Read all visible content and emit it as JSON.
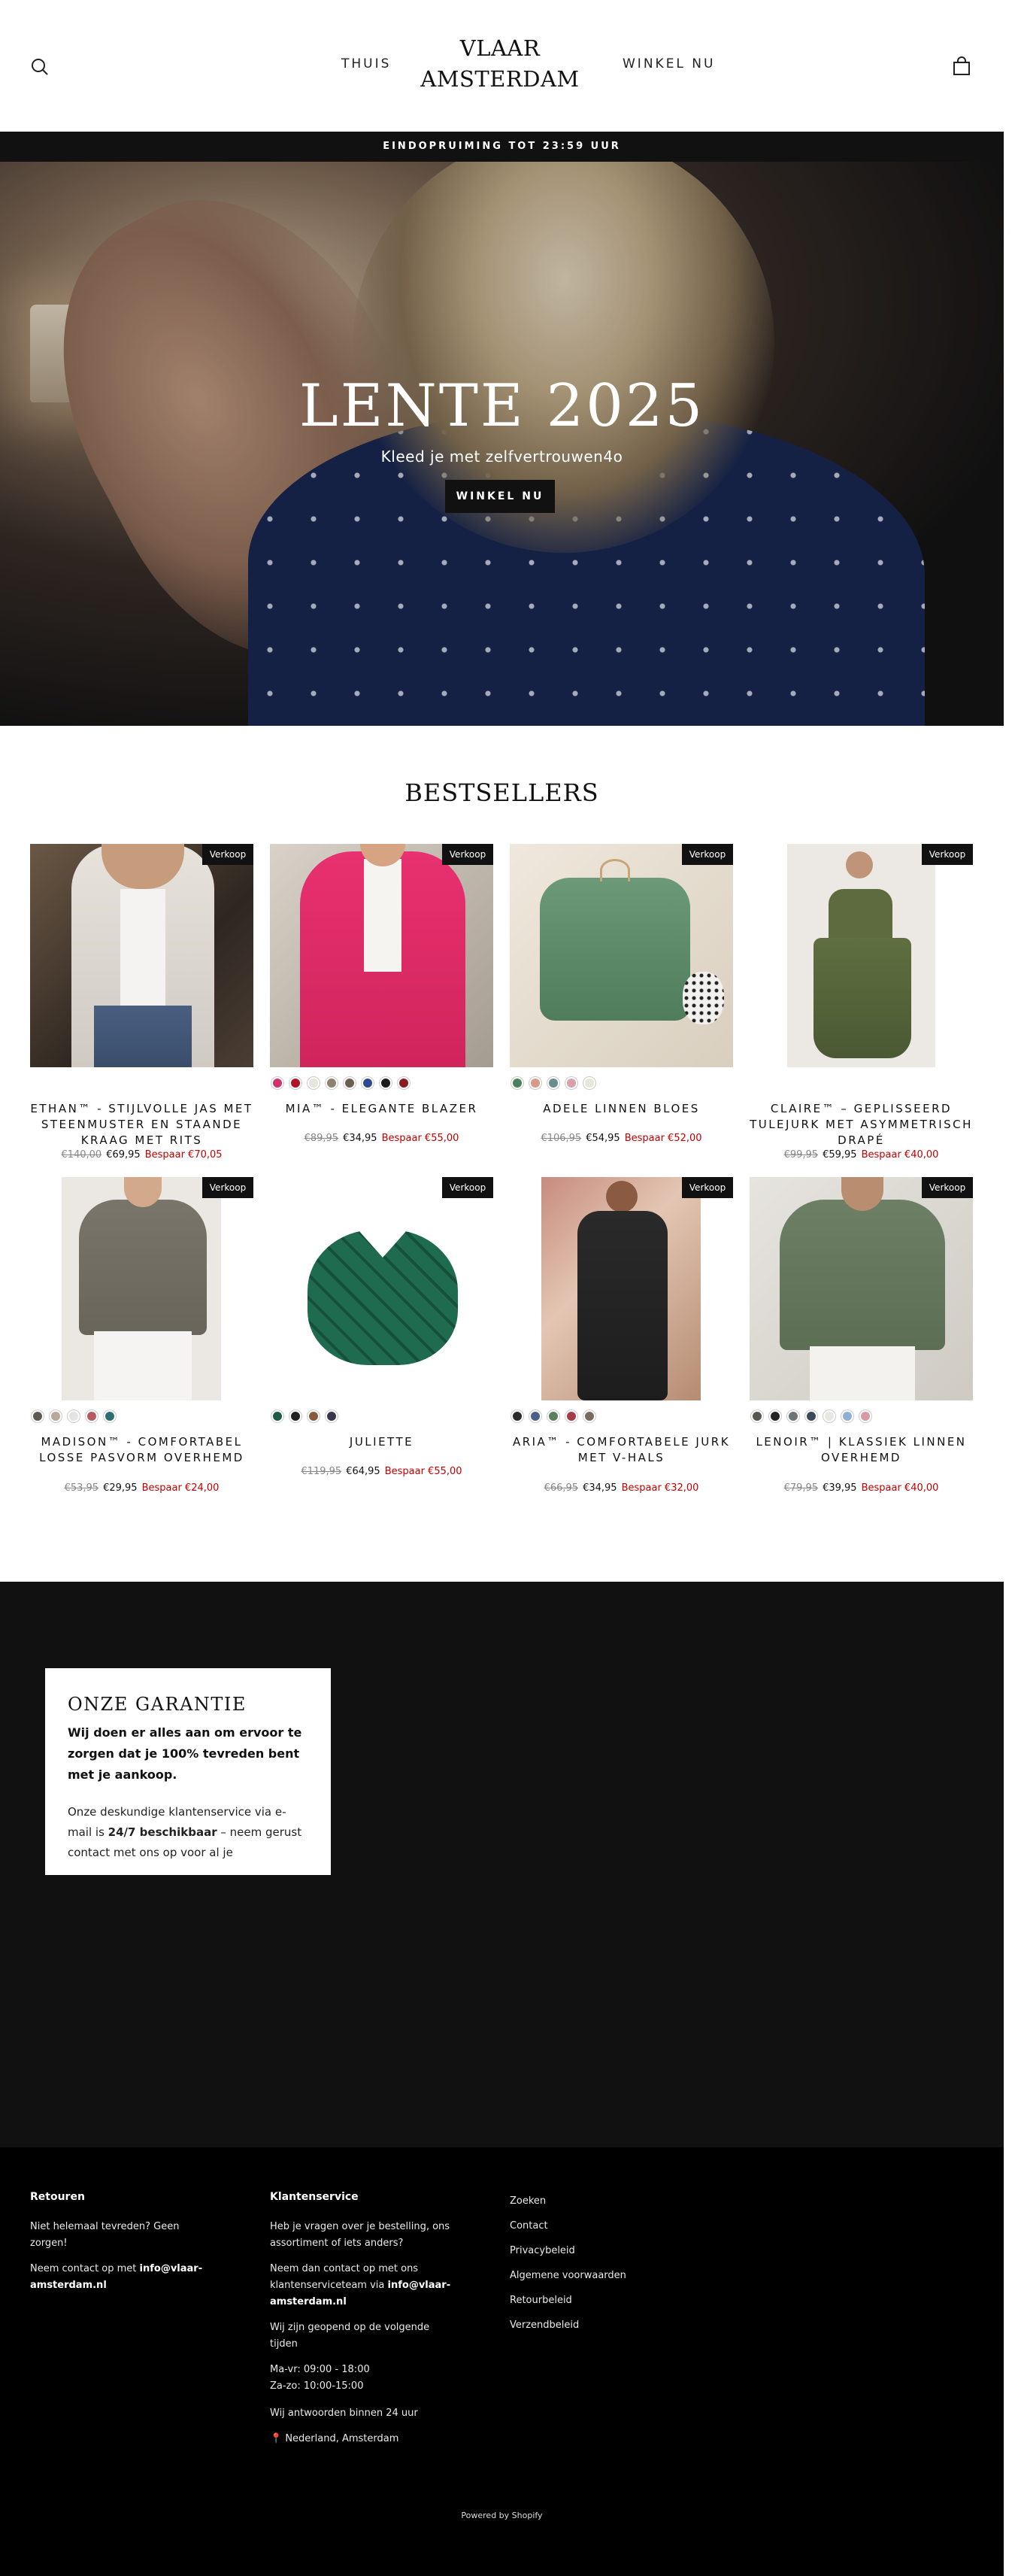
{
  "header": {
    "logo_line1": "VLAAR",
    "logo_line2": "AMSTERDAM",
    "nav": {
      "home": "THUIS",
      "shop": "WINKEL NU"
    }
  },
  "announcement": "EINDOPRUIMING TOT 23:59 UUR",
  "hero": {
    "title": "LENTE 2025",
    "subtitle": "Kleed je met zelfvertrouwen4o",
    "button": "WINKEL NU"
  },
  "bestsellers": {
    "title": "BESTSELLERS",
    "products": [
      {
        "name": "ETHAN™ - STIJLVOLLE JAS MET STEENMUSTER EN STAANDE KRAAG MET RITS",
        "badge": "Verkoop",
        "old_price": "€140,00",
        "new_price": "€69,95",
        "save": "Bespaar €70,05",
        "swatches": []
      },
      {
        "name": "MIA™ - ELEGANTE BLAZER",
        "badge": "Verkoop",
        "old_price": "€89,95",
        "new_price": "€34,95",
        "save": "Bespaar €55,00",
        "swatches": [
          "#d3306e",
          "#b3132a",
          "#e8e4dc",
          "#8b8170",
          "#6b5f4e",
          "#2e4a8f",
          "#1c1c1c",
          "#8a1c22"
        ]
      },
      {
        "name": "ADELE LINNEN BLOES",
        "badge": "Verkoop",
        "old_price": "€106,95",
        "new_price": "€54,95",
        "save": "Bespaar €52,00",
        "swatches": [
          "#4d7f5e",
          "#d79a86",
          "#6b8c8f",
          "#d8a0a8",
          "#e9e5dc"
        ]
      },
      {
        "name": "CLAIRE™ – GEPLISSEERD TULEJURK MET ASYMMETRISCH DRAPÉ",
        "badge": "Verkoop",
        "old_price": "€99,95",
        "new_price": "€59,95",
        "save": "Bespaar €40,00",
        "swatches": []
      },
      {
        "name": "MADISON™ - COMFORTABEL LOSSE PASVORM OVERHEMD",
        "badge": "Verkoop",
        "old_price": "€53,95",
        "new_price": "€29,95",
        "save": "Bespaar €24,00",
        "swatches": [
          "#5e5950",
          "#b9a99a",
          "#e5e3e0",
          "#b65a62",
          "#2d6e73"
        ]
      },
      {
        "name": "JULIETTE",
        "badge": "Verkoop",
        "old_price": "€119,95",
        "new_price": "€64,95",
        "save": "Bespaar €55,00",
        "swatches": [
          "#1e5c45",
          "#222222",
          "#8a5a3c",
          "#3a3650"
        ]
      },
      {
        "name": "ARIA™ - COMFORTABELE JURK MET V-HALS",
        "badge": "Verkoop",
        "old_price": "€66,95",
        "new_price": "€34,95",
        "save": "Bespaar €32,00",
        "swatches": [
          "#2b2b2b",
          "#4a5f8c",
          "#5d7f5c",
          "#a33b4a",
          "#7b6b5c"
        ]
      },
      {
        "name": "LENOIR™ | KLASSIEK LINNEN OVERHEMD",
        "badge": "Verkoop",
        "old_price": "€79,95",
        "new_price": "€39,95",
        "save": "Bespaar €40,00",
        "swatches": [
          "#55594f",
          "#222222",
          "#6e7378",
          "#3c4a5c",
          "#e9e7e2",
          "#8fb0d6",
          "#d99aa6"
        ]
      }
    ]
  },
  "guarantee": {
    "title": "ONZE GARANTIE",
    "lead": "Wij doen er alles aan om ervoor te zorgen dat je 100% tevreden bent met je aankoop.",
    "body_prefix": "Onze deskundige klantenservice via e-mail is ",
    "body_bold": "24/7 beschikbaar",
    "body_suffix": " – neem gerust contact met ons op voor al je"
  },
  "footer": {
    "returns": {
      "heading": "Retouren",
      "p1": "Niet helemaal tevreden? Geen zorgen!",
      "p2_prefix": "Neem contact op met ",
      "p2_email": "info@vlaar-amsterdam.nl"
    },
    "service": {
      "heading": "Klantenservice",
      "p1": "Heb je vragen over je bestelling, ons assortiment of iets anders?",
      "p2_prefix": "Neem dan contact op met ons klantenserviceteam via ",
      "p2_email": "info@vlaar-amsterdam.nl",
      "p3": "Wij zijn geopend op de volgende tijden",
      "hours1": "Ma-vr: 09:00 - 18:00",
      "hours2": "Za-zo: 10:00-15:00",
      "p4": "Wij antwoorden binnen 24 uur",
      "location": "Nederland, Amsterdam"
    },
    "links": [
      "Zoeken",
      "Contact",
      "Privacybeleid",
      "Algemene voorwaarden",
      "Retourbeleid",
      "Verzendbeleid"
    ],
    "powered": "Powered by Shopify"
  }
}
